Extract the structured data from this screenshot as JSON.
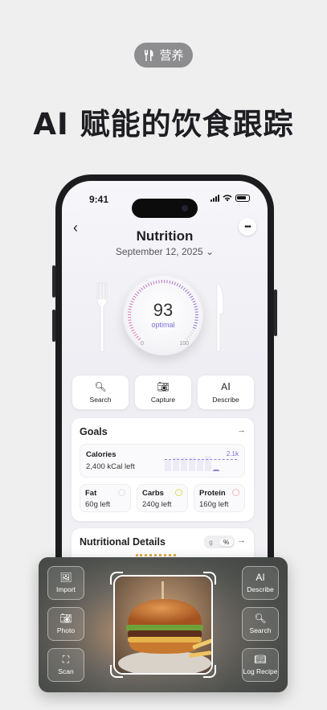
{
  "badge": {
    "icon": "fork-knife-icon",
    "label": "营养"
  },
  "headline": "AI 赋能的饮食跟踪",
  "status_bar": {
    "time": "9:41"
  },
  "screen": {
    "title": "Nutrition",
    "date": "September 12, 2025",
    "score": {
      "value": "93",
      "label": "optimal",
      "min": "0",
      "max": "100",
      "fraction": 0.93
    },
    "quick_actions": [
      {
        "label": "Search",
        "icon": "search-icon"
      },
      {
        "label": "Capture",
        "icon": "camera-icon"
      },
      {
        "label": "Describe",
        "icon": "text-cursor-icon"
      }
    ],
    "goals": {
      "title": "Goals",
      "calories": {
        "name": "Calories",
        "value": "2,400 kCal left",
        "target": "2.1k"
      },
      "macros": [
        {
          "name": "Fat",
          "value": "60g left",
          "color": "#e2e2e6"
        },
        {
          "name": "Carbs",
          "value": "240g left",
          "color": "#d9de5a"
        },
        {
          "name": "Protein",
          "value": "160g left",
          "color": "#f3b9c0"
        }
      ]
    },
    "details": {
      "title": "Nutritional Details",
      "toggle": [
        "g",
        "%"
      ],
      "active": "%"
    }
  },
  "panel": {
    "left": [
      {
        "label": "Import",
        "icon": "image-plus-icon"
      },
      {
        "label": "Photo",
        "icon": "camera-icon"
      },
      {
        "label": "Scan",
        "icon": "scan-icon"
      }
    ],
    "right": [
      {
        "label": "Describe",
        "icon": "text-cursor-icon"
      },
      {
        "label": "Search",
        "icon": "search-icon"
      },
      {
        "label": "Log Recipe",
        "icon": "recipe-book-icon"
      }
    ]
  }
}
